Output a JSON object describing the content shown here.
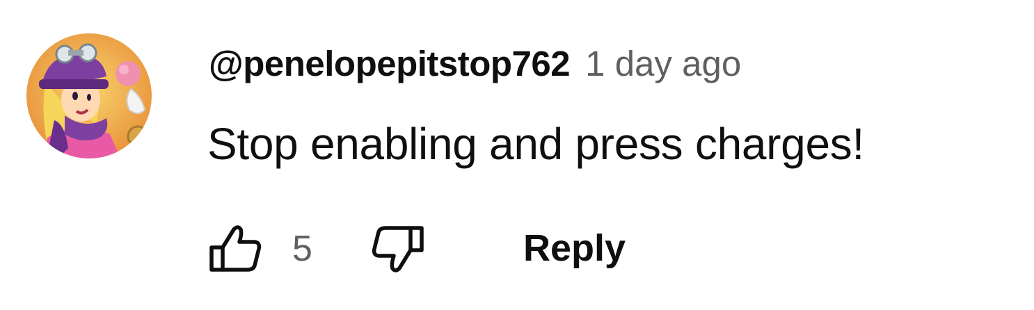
{
  "comment": {
    "author": "@penelopepitstop762",
    "timestamp": "1 day ago",
    "text": "Stop enabling and press charges!",
    "avatar_icon": "cartoon-avatar-icon",
    "like_count": "5"
  },
  "actions": {
    "like_icon": "thumbs-up-icon",
    "dislike_icon": "thumbs-down-icon",
    "reply_label": "Reply"
  },
  "colors": {
    "author": "#0f0f0f",
    "timestamp": "#606060",
    "avatar_bg": "#f2b43c",
    "avatar_hat": "#7d3fa0",
    "avatar_skin": "#ffd9b3",
    "avatar_hair": "#f5d65a",
    "avatar_dress": "#e85aa6"
  }
}
